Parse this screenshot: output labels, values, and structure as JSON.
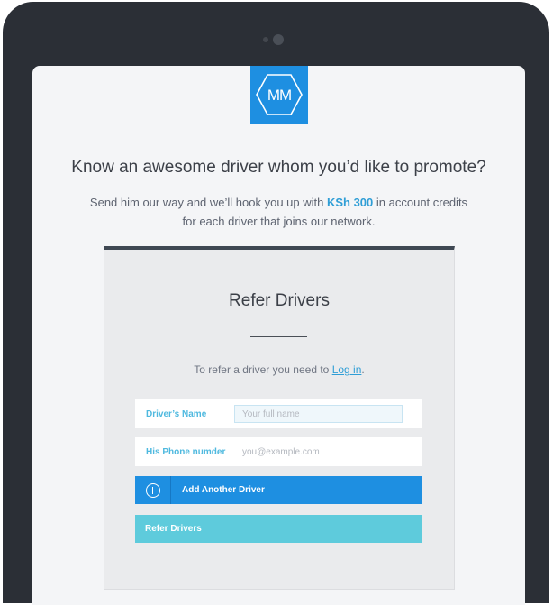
{
  "brand": {
    "logo_text": "MM",
    "color": "#1e8fe1"
  },
  "hero": {
    "headline": "Know an awesome driver whom you’d like to promote?",
    "line1_before": "Send him our way and we’ll hook you up with ",
    "credit_amount": "KSh 300",
    "line1_after": " in account credits",
    "line2": "for each driver that joins our network."
  },
  "card": {
    "title": "Refer Drivers",
    "login_prefix": "To refer a driver you need to ",
    "login_link": "Log in",
    "login_suffix": ".",
    "fields": [
      {
        "label": "Driver’s Name",
        "placeholder": "Your full name"
      },
      {
        "label": "His Phone numder",
        "placeholder": "you@example.com"
      }
    ],
    "add_button": "Add Another Driver",
    "submit_button": "Refer Drivers"
  },
  "colors": {
    "accent": "#1e8fe1",
    "submit": "#5ecbdc",
    "link": "#2f9ed6",
    "device_frame": "#2b2f36"
  },
  "icons": {
    "camera": "camera-icon",
    "add": "add-circle-icon",
    "logo": "hexagon-logo-icon"
  }
}
